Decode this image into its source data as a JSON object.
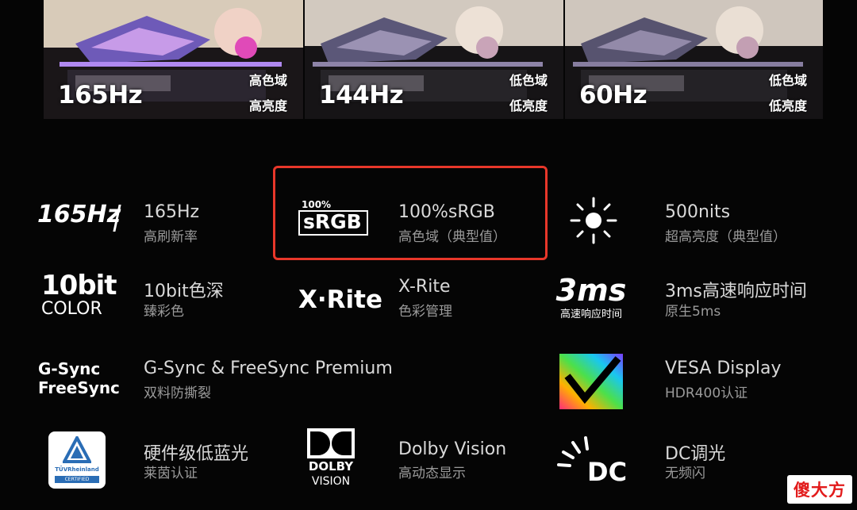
{
  "shots": [
    {
      "hz": "165Hz",
      "line1": "高色域",
      "line2": "高亮度"
    },
    {
      "hz": "144Hz",
      "line1": "低色域",
      "line2": "低亮度"
    },
    {
      "hz": "60Hz",
      "line1": "低色域",
      "line2": "低亮度"
    }
  ],
  "features": {
    "hz165": {
      "icon_text": "165Hz",
      "title": "165Hz",
      "sub": "高刷新率"
    },
    "srgb": {
      "icon_top": "100%",
      "icon_main": "sRGB",
      "title": "100%sRGB",
      "sub": "高色域（典型值）"
    },
    "nits": {
      "title": "500nits",
      "sub": "超高亮度（典型值）"
    },
    "bit10": {
      "icon_main": "10bit",
      "icon_sub": "COLOR",
      "title": "10bit色深",
      "sub": "臻彩色"
    },
    "xrite": {
      "icon_text": "X·Rite",
      "title": "X-Rite",
      "sub": "色彩管理"
    },
    "ms3": {
      "icon_main": "3ms",
      "icon_sub": "高速响应时间",
      "title": "3ms高速响应时间",
      "sub": "原生5ms"
    },
    "gsync": {
      "icon_line1": "G-Sync",
      "icon_line2": "FreeSync",
      "title": "G-Sync & FreeSync Premium",
      "sub": "双料防撕裂"
    },
    "vesa": {
      "title": "VESA Display",
      "sub": "HDR400认证"
    },
    "tuv": {
      "icon_line1": "TÜVRheinland",
      "icon_line2": "CERTIFIED",
      "title": "硬件级低蓝光",
      "sub": "莱茵认证"
    },
    "dolby": {
      "icon_line1": "DOLBY",
      "icon_line2": "VISION",
      "title": "Dolby Vision",
      "sub": "高动态显示"
    },
    "dc": {
      "icon_text": "DC",
      "title": "DC调光",
      "sub": "无频闪"
    }
  },
  "watermark": "傻大方",
  "colors": {
    "highlight": "#e8372a",
    "title": "#d9d9d9",
    "sub": "#9a9a9a",
    "watermark": "#e21b1b"
  }
}
